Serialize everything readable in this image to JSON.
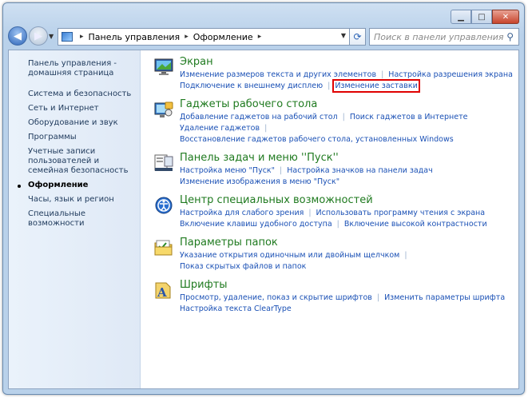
{
  "addressbar": {
    "crumbs": [
      "Панель управления",
      "Оформление"
    ],
    "separator": "▸"
  },
  "search": {
    "placeholder": "Поиск в панели управления"
  },
  "sidebar": {
    "items": [
      {
        "label": "Панель управления - домашняя страница"
      },
      {
        "label": "Система и безопасность"
      },
      {
        "label": "Сеть и Интернет"
      },
      {
        "label": "Оборудование и звук"
      },
      {
        "label": "Программы"
      },
      {
        "label": "Учетные записи пользователей и семейная безопасность"
      },
      {
        "label": "Оформление",
        "active": true
      },
      {
        "label": "Часы, язык и регион"
      },
      {
        "label": "Специальные возможности"
      }
    ]
  },
  "categories": [
    {
      "title": "Экран",
      "icon": "monitor-icon",
      "links": [
        [
          "Изменение размеров текста и других элементов",
          "Настройка разрешения экрана"
        ],
        [
          "Подключение к внешнему дисплею",
          "Изменение заставки"
        ]
      ]
    },
    {
      "title": "Гаджеты рабочего стола",
      "icon": "gadgets-icon",
      "links": [
        [
          "Добавление гаджетов на рабочий стол",
          "Поиск гаджетов в Интернете"
        ],
        [
          "Удаление гаджетов",
          "Восстановление гаджетов рабочего стола, установленных Windows"
        ]
      ]
    },
    {
      "title": "Панель задач и меню ''Пуск''",
      "icon": "taskbar-icon",
      "links": [
        [
          "Настройка меню \"Пуск\"",
          "Настройка значков на панели задач"
        ],
        [
          "Изменение изображения в меню \"Пуск\""
        ]
      ]
    },
    {
      "title": "Центр специальных возможностей",
      "icon": "accessibility-icon",
      "links": [
        [
          "Настройка для слабого зрения",
          "Использовать программу чтения с экрана"
        ],
        [
          "Включение клавиш удобного доступа",
          "Включение высокой контрастности"
        ]
      ]
    },
    {
      "title": "Параметры папок",
      "icon": "folder-options-icon",
      "links": [
        [
          "Указание открытия одиночным или двойным щелчком",
          "Показ скрытых файлов и папок"
        ]
      ]
    },
    {
      "title": "Шрифты",
      "icon": "fonts-icon",
      "links": [
        [
          "Просмотр, удаление, показ и скрытие шрифтов",
          "Изменить параметры шрифта"
        ],
        [
          "Настройка текста ClearType"
        ]
      ]
    }
  ],
  "highlight": {
    "link": "Изменение заставки",
    "color": "#e00000"
  }
}
